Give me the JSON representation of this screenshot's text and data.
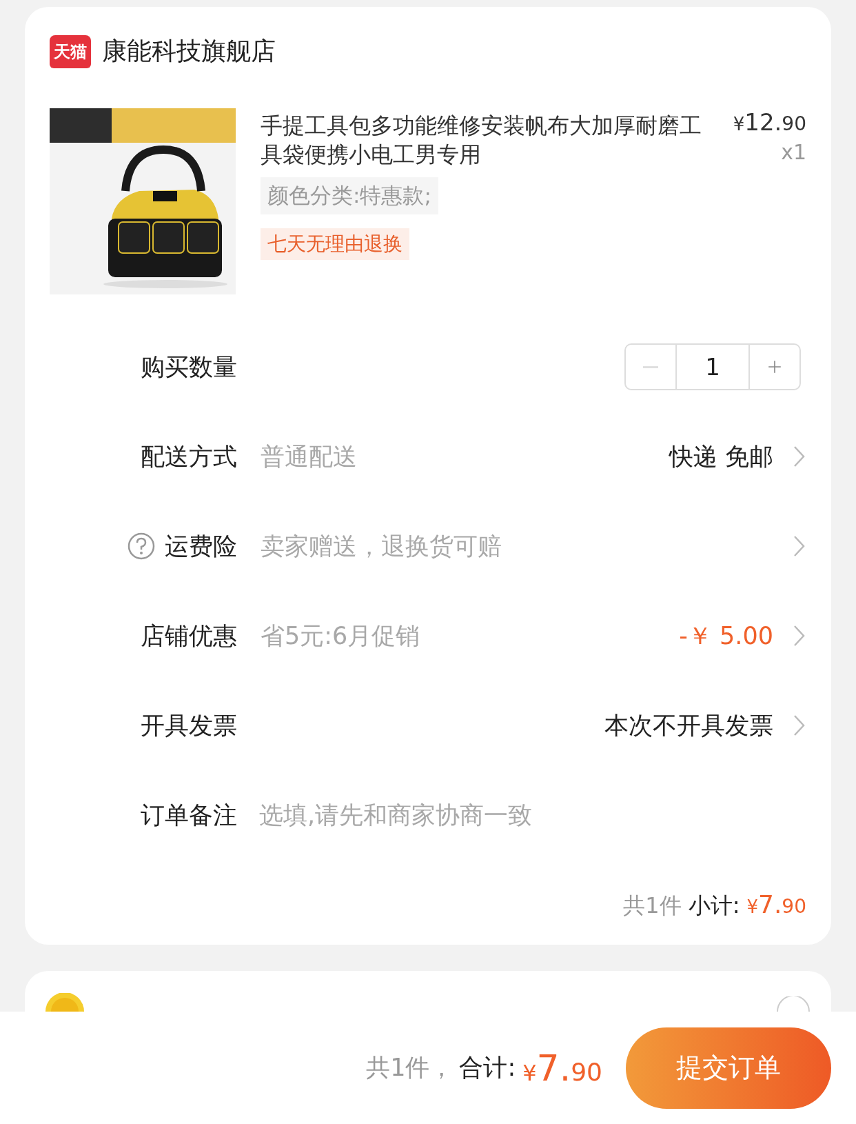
{
  "store": {
    "badge": "天猫",
    "name": "康能科技旗舰店"
  },
  "product": {
    "kind": "picture",
    "title": "手提工具包多功能维修安装帆布大加厚耐磨工具袋便携小电工男专用",
    "price_symbol": "¥",
    "price_int": "12.",
    "price_dec": "90",
    "quantity": "x1",
    "sku": "颜色分类:特惠款;",
    "tag": "七天无理由退换"
  },
  "rows": [
    {
      "kind": "stepper",
      "label": "购买数量",
      "value": "1",
      "decrease_disabled": true
    },
    {
      "kind": "select",
      "label": "配送方式",
      "value": "普通配送",
      "right": "快递 免邮"
    },
    {
      "kind": "help",
      "label": "运费险",
      "value": "卖家赠送，退换货可赔"
    },
    {
      "kind": "discount",
      "label": "店铺优惠",
      "value": "省5元:6月促销",
      "right": "-￥ 5.00"
    },
    {
      "kind": "select",
      "label": "开具发票",
      "right": "本次不开具发票"
    },
    {
      "kind": "note",
      "label": "订单备注",
      "placeholder": "选填,请先和商家协商一致"
    }
  ],
  "subtotal": {
    "count": "共1件",
    "label": "小计:",
    "symbol": "¥",
    "int": "7.",
    "dec": "90"
  },
  "coins": {
    "checked": false
  },
  "footer": {
    "count": "共1件，",
    "label": "合计:",
    "symbol": "¥",
    "int": "7.",
    "dec": "90",
    "button": "提交订单"
  }
}
